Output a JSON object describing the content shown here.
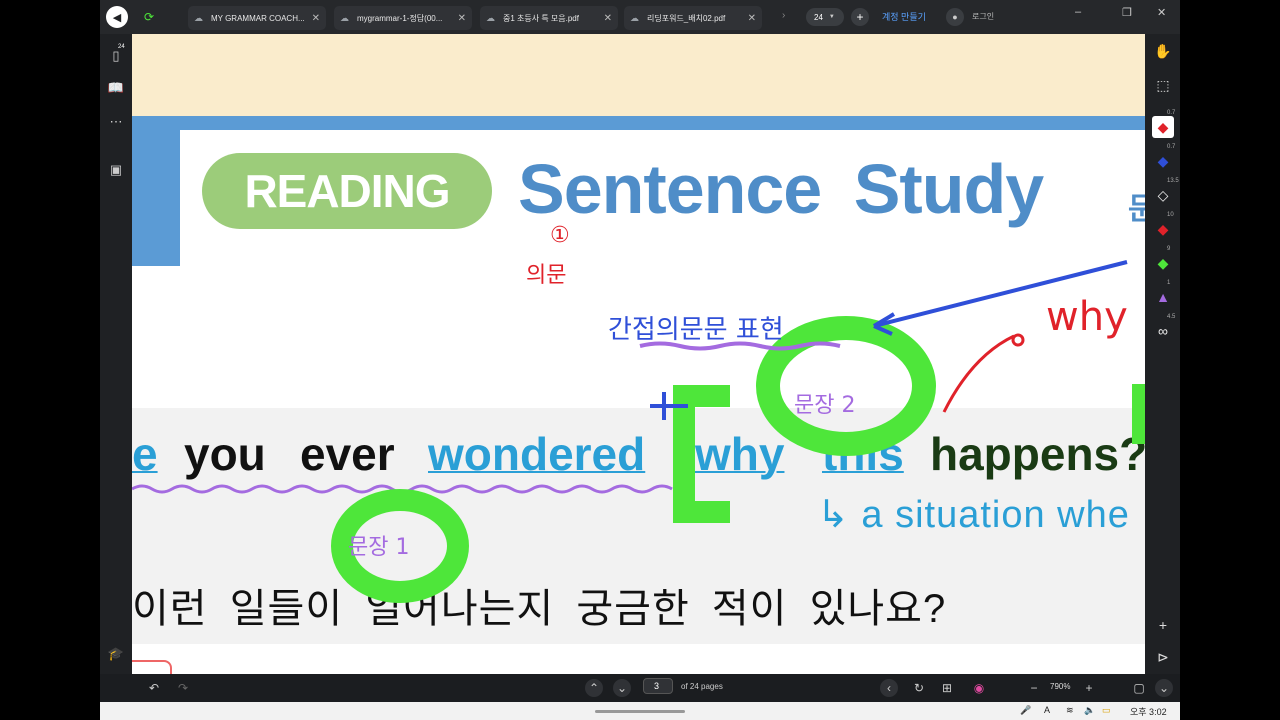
{
  "tabs": [
    {
      "label": "MY GRAMMAR COACH..."
    },
    {
      "label": "mygrammar-1-정답(00..."
    },
    {
      "label": "중1 초등사 특 모음.pdf"
    },
    {
      "label": "리딩포워드_배치02.pdf"
    }
  ],
  "header": {
    "page_count": "24",
    "create_account": "계정 만들기",
    "login": "로그인"
  },
  "left_rail": {
    "badge_count": "24"
  },
  "document": {
    "badge": "READING",
    "title": "Sentence Study",
    "title_tail": "문",
    "sentence_words": [
      "e",
      "you",
      "ever",
      "wondered",
      "why",
      "this",
      "happens?"
    ],
    "sub_note": "↳ a situation whe",
    "korean_line": "이런 일들이 일어나는지 궁금한 적이 있나요?",
    "handwriting": {
      "circled_num": "①",
      "label_1": "의문",
      "arrow_note": "간접의문문 표현",
      "question_mark": "why",
      "circle_a": "문장 2",
      "circle_b": "문장 1",
      "plus_mark": "+"
    }
  },
  "right_tools": {
    "sizes": [
      "0.7",
      "0.7",
      "13.5",
      "10",
      "9",
      "1",
      "4.5"
    ]
  },
  "bottom_bar": {
    "current_page": "3",
    "of_pages": "of 24 pages",
    "zoom": "790%"
  },
  "system_bar": {
    "ime": "A",
    "time": "오후 3:02"
  },
  "colors": {
    "accent_blue": "#4f8dc8",
    "reading_green": "#9ccc7a",
    "highlight_green": "#4ee63a",
    "ink_red": "#e0222a",
    "ink_blue": "#2f4fd8",
    "ink_purple": "#a46be0",
    "sentence_blue": "#2a9fd6"
  }
}
